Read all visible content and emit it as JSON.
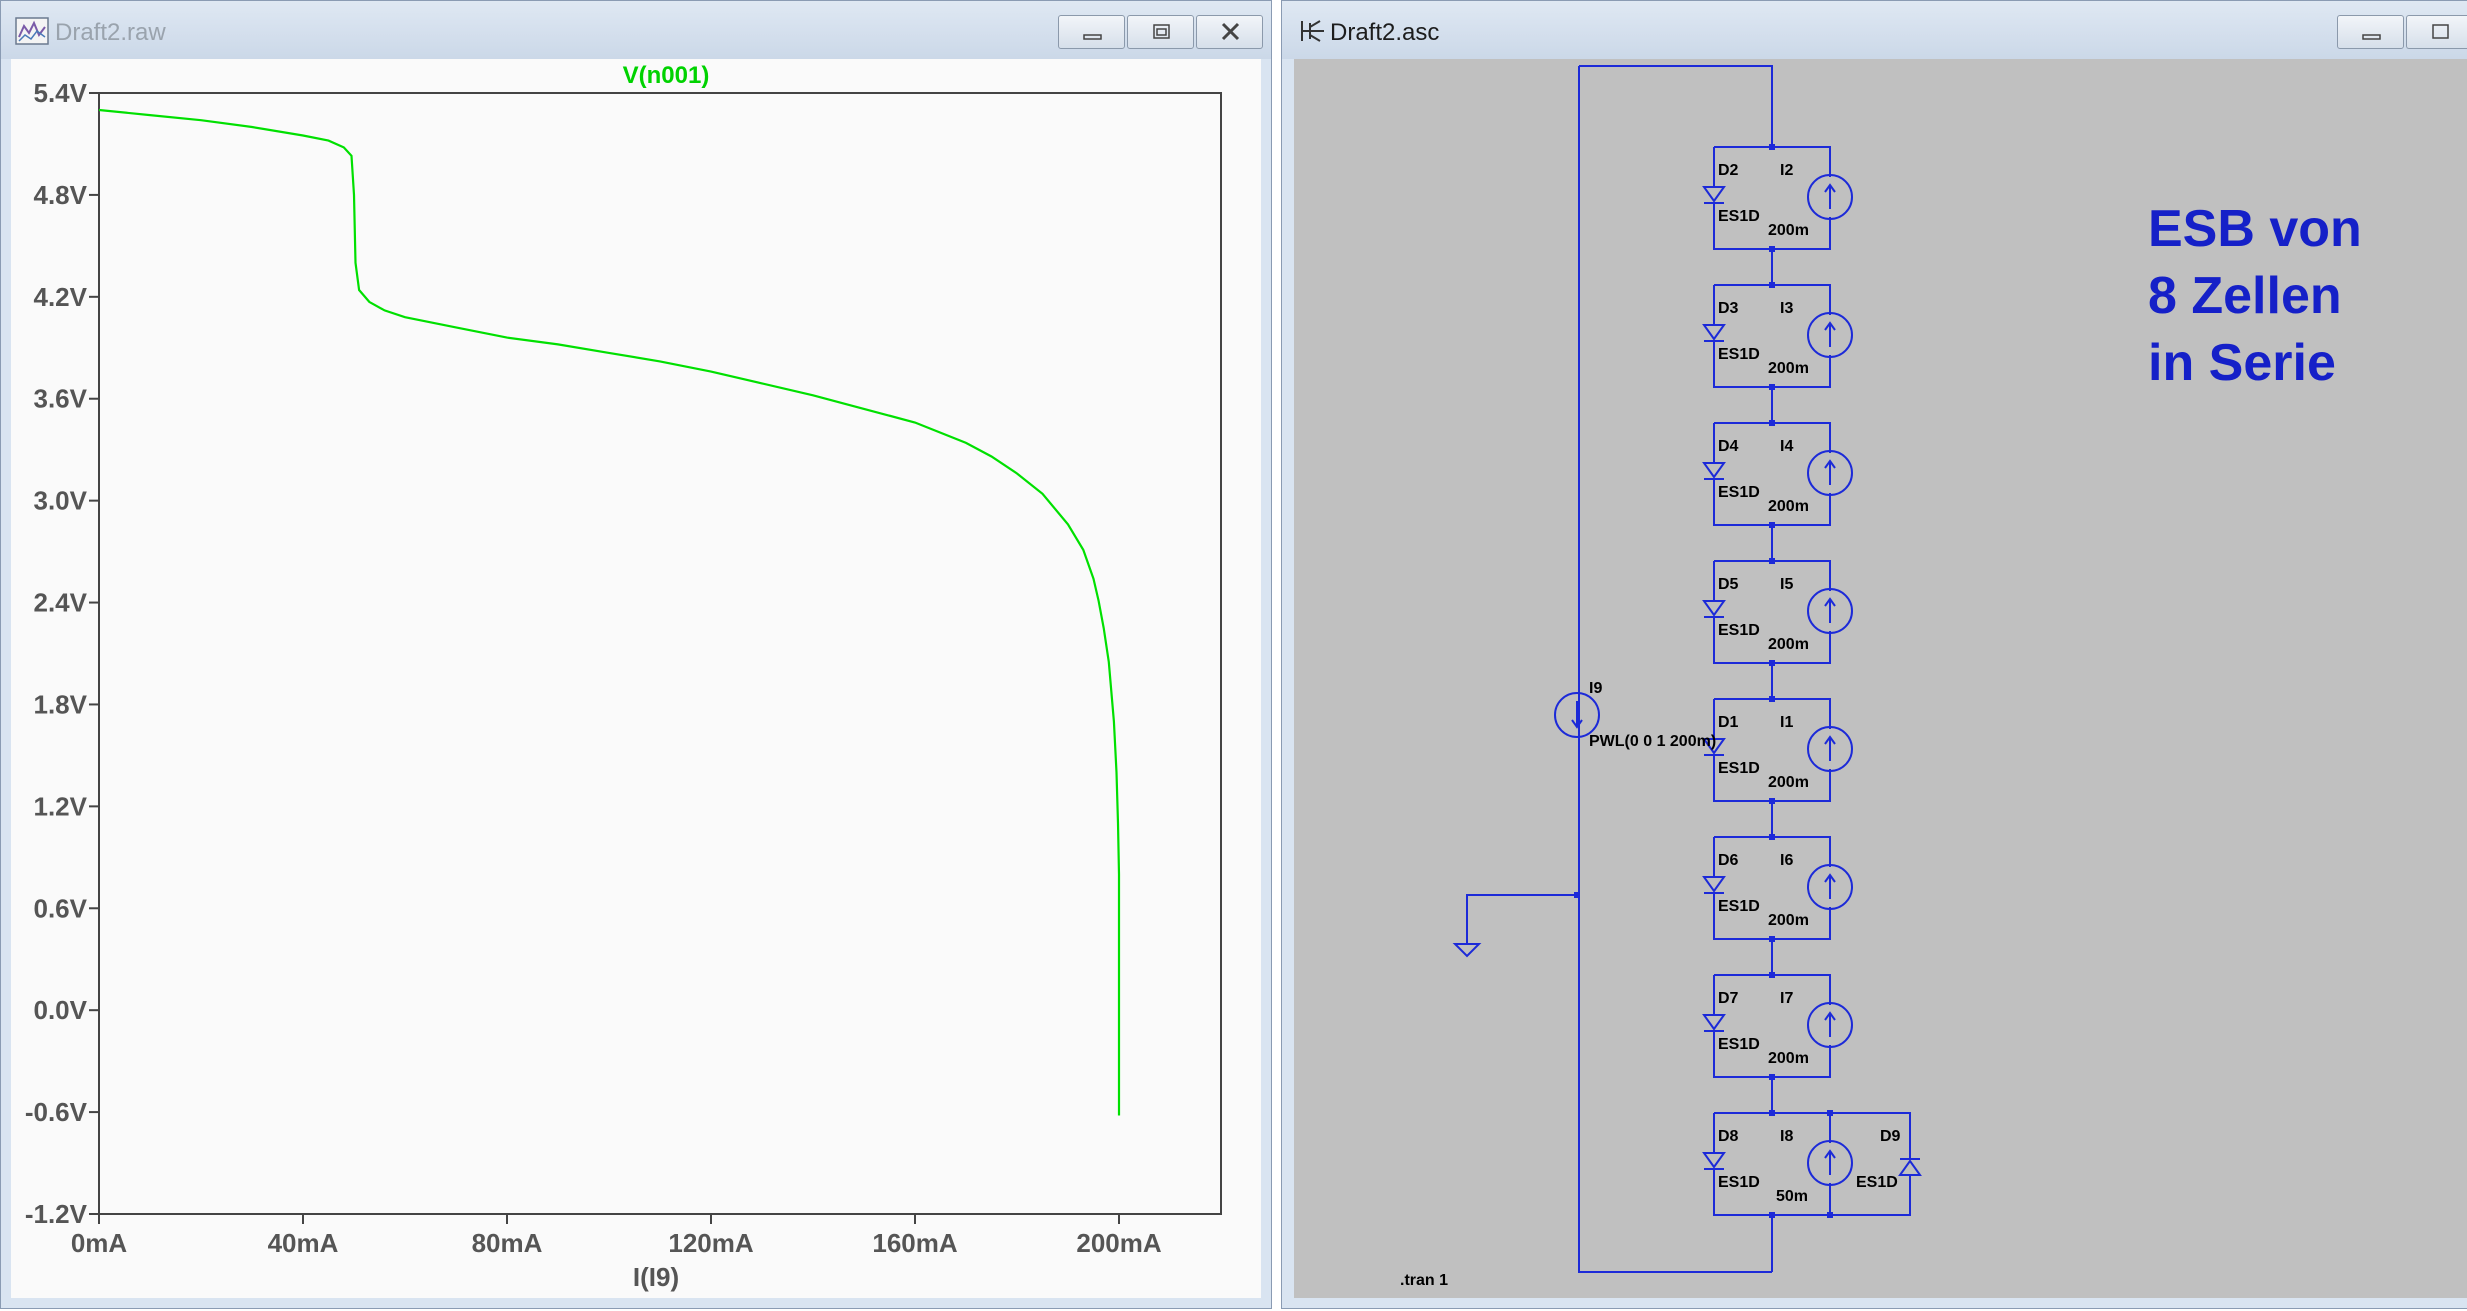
{
  "raw_window": {
    "title": "Draft2.raw",
    "minimize_icon": "minimize-icon",
    "maximize_icon": "maximize-icon",
    "close_icon": "close-icon"
  },
  "asc_window": {
    "title": "Draft2.asc",
    "minimize_icon": "minimize-icon",
    "maximize_icon": "maximize-icon"
  },
  "chart_data": {
    "type": "line",
    "title": "V(n001)",
    "xlabel": "I(I9)",
    "ylabel": "",
    "xlim": [
      0,
      220
    ],
    "ylim": [
      -1.2,
      5.4
    ],
    "x_ticks": [
      "0mA",
      "40mA",
      "80mA",
      "120mA",
      "160mA",
      "200mA"
    ],
    "x_tick_values": [
      0,
      40,
      80,
      120,
      160,
      200
    ],
    "y_ticks": [
      "5.4V",
      "4.8V",
      "4.2V",
      "3.6V",
      "3.0V",
      "2.4V",
      "1.8V",
      "1.2V",
      "0.6V",
      "0.0V",
      "-0.6V",
      "-1.2V"
    ],
    "y_tick_values": [
      5.4,
      4.8,
      4.2,
      3.6,
      3.0,
      2.4,
      1.8,
      1.2,
      0.6,
      0.0,
      -0.6,
      -1.2
    ],
    "grid": false,
    "series": [
      {
        "name": "V(n001)",
        "color": "#00e000",
        "x": [
          0,
          10,
          20,
          30,
          40,
          45,
          48,
          49.5,
          50,
          50.3,
          51,
          53,
          56,
          60,
          70,
          80,
          90,
          100,
          110,
          120,
          130,
          140,
          150,
          160,
          170,
          175,
          180,
          185,
          190,
          193,
          195,
          196,
          197,
          198,
          199,
          199.5,
          199.8,
          200,
          200,
          200
        ],
        "values": [
          5.3,
          5.27,
          5.24,
          5.2,
          5.15,
          5.12,
          5.08,
          5.03,
          4.8,
          4.4,
          4.24,
          4.17,
          4.12,
          4.08,
          4.02,
          3.96,
          3.92,
          3.87,
          3.82,
          3.76,
          3.69,
          3.62,
          3.54,
          3.46,
          3.34,
          3.26,
          3.16,
          3.04,
          2.86,
          2.71,
          2.54,
          2.41,
          2.25,
          2.05,
          1.7,
          1.4,
          1.1,
          0.8,
          0.0,
          -0.62
        ]
      }
    ]
  },
  "schematic": {
    "annotation": [
      "ESB von",
      "8 Zellen",
      "in Serie"
    ],
    "source": {
      "name": "I9",
      "value": "PWL(0 0 1 200m)"
    },
    "directive": ".tran 1",
    "cells": [
      {
        "diode": "D2",
        "diode_model": "ES1D",
        "source": "I2",
        "source_value": "200m"
      },
      {
        "diode": "D3",
        "diode_model": "ES1D",
        "source": "I3",
        "source_value": "200m"
      },
      {
        "diode": "D4",
        "diode_model": "ES1D",
        "source": "I4",
        "source_value": "200m"
      },
      {
        "diode": "D5",
        "diode_model": "ES1D",
        "source": "I5",
        "source_value": "200m"
      },
      {
        "diode": "D1",
        "diode_model": "ES1D",
        "source": "I1",
        "source_value": "200m"
      },
      {
        "diode": "D6",
        "diode_model": "ES1D",
        "source": "I6",
        "source_value": "200m"
      },
      {
        "diode": "D7",
        "diode_model": "ES1D",
        "source": "I7",
        "source_value": "200m"
      },
      {
        "diode": "D8",
        "diode_model": "ES1D",
        "source": "I8",
        "source_value": "50m"
      }
    ],
    "extra_diode": {
      "name": "D9",
      "model": "ES1D"
    }
  }
}
